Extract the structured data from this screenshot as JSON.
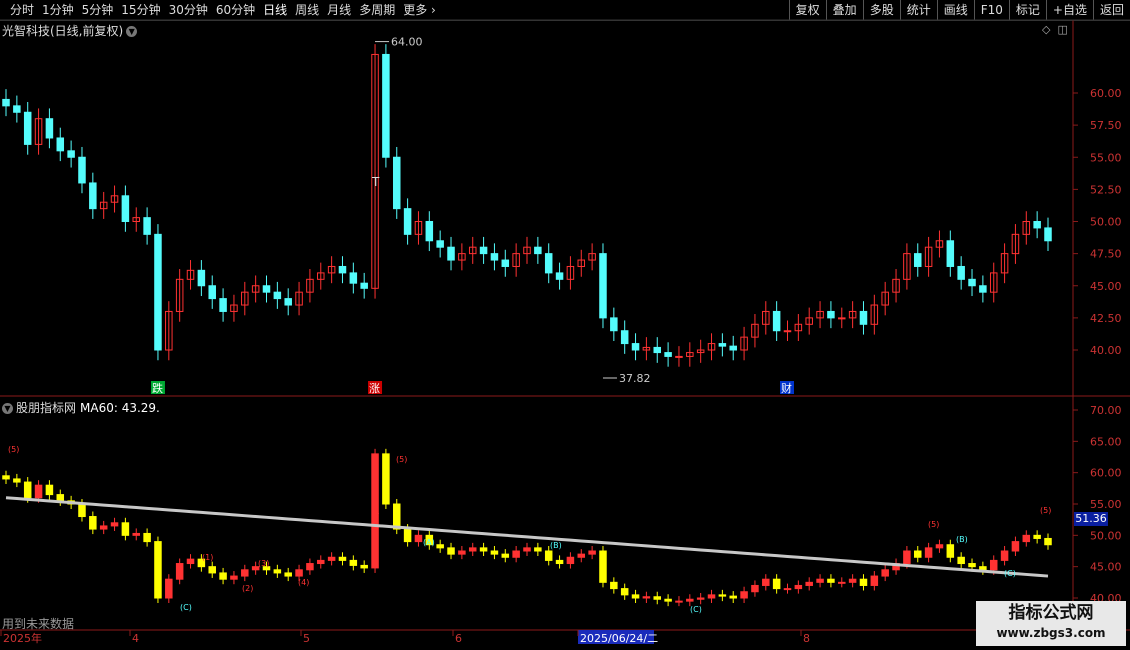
{
  "toolbar": {
    "periods": [
      "分时",
      "1分钟",
      "5分钟",
      "15分钟",
      "30分钟",
      "60分钟",
      "日线",
      "周线",
      "月线",
      "多周期",
      "更多"
    ],
    "buttons": [
      "复权",
      "叠加",
      "多股",
      "统计",
      "画线",
      "F10",
      "标记",
      "+自选",
      "返回"
    ]
  },
  "main_panel": {
    "title": "光智科技(日线,前复权)",
    "y_ticks": [
      "60.00",
      "57.50",
      "55.00",
      "52.50",
      "50.00",
      "47.50",
      "45.00",
      "42.50",
      "40.00"
    ],
    "high_label": "64.00",
    "low_label": "37.82",
    "markers": [
      "跌",
      "涨",
      "财"
    ],
    "t_marker": "T"
  },
  "indicator_panel": {
    "name": "股朋指标网",
    "ma_label": "MA60: 43.29.",
    "y_ticks": [
      "70.00",
      "65.00",
      "60.00",
      "55.00",
      "50.00",
      "45.00",
      "40.00"
    ],
    "current_price": "51.36",
    "wave_labels": [
      "(5)",
      "(5)",
      "(5)",
      "(5)",
      "(B)",
      "(B)",
      "(C)",
      "(C)",
      "(C)",
      "(A)",
      "(1)",
      "(2)",
      "(3)",
      "(4)",
      "T"
    ]
  },
  "x_axis": {
    "labels": [
      "2025年",
      "4",
      "5",
      "6",
      "2025/06/24/二",
      "8"
    ]
  },
  "footer_note": "用到未来数据",
  "watermark": {
    "title": "指标公式网",
    "url": "www.zbgs3.com"
  },
  "colors": {
    "up": "#ff3232",
    "down": "#54fcfc",
    "indicator_down": "#ffff00",
    "ma_line": "#c8c8c8",
    "grid": "#8b1a1a"
  }
}
